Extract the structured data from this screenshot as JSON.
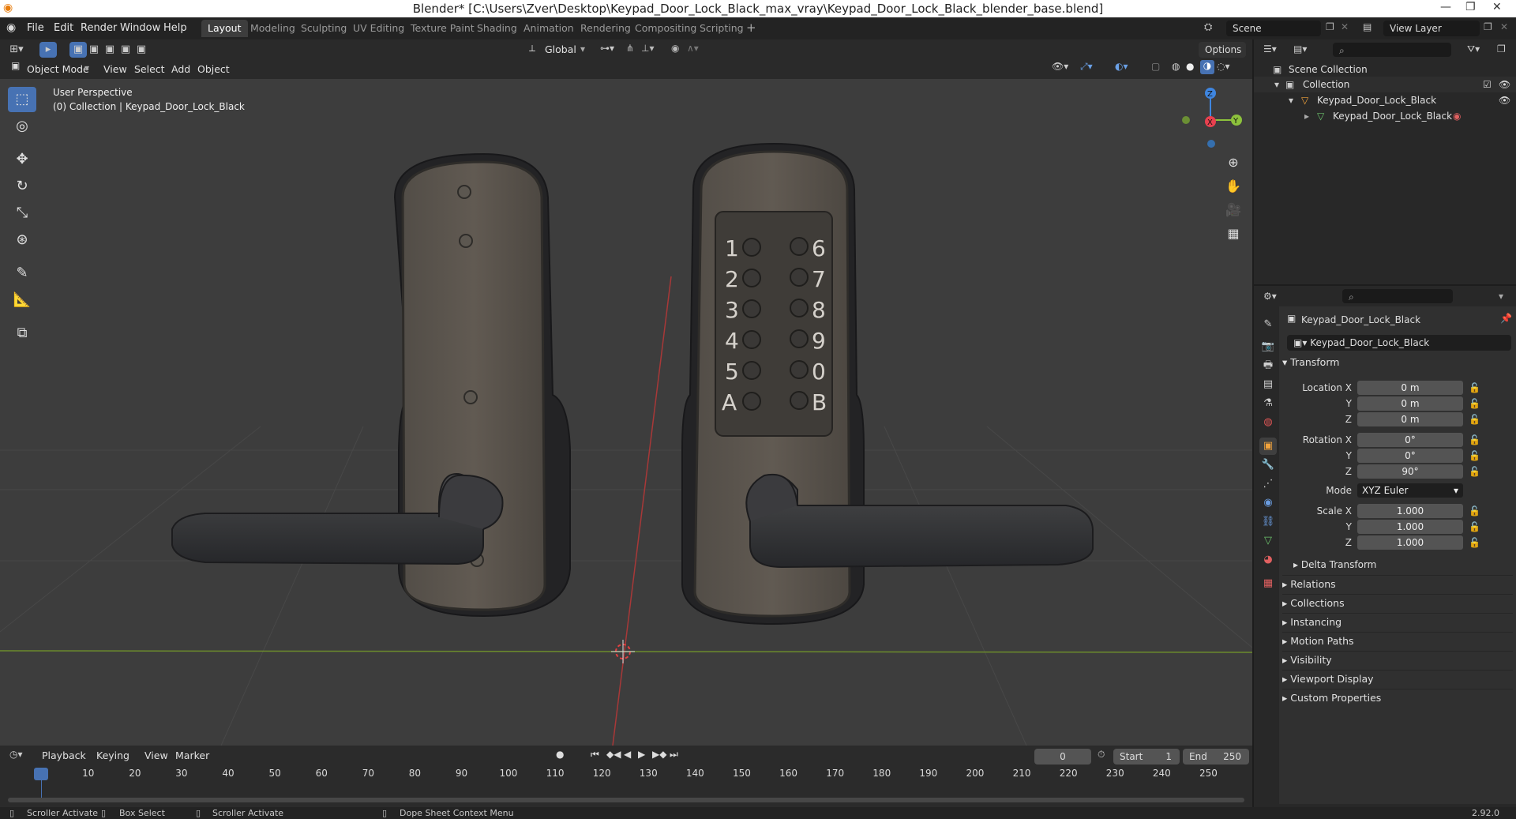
{
  "window": {
    "title": "Blender* [C:\\Users\\Zver\\Desktop\\Keypad_Door_Lock_Black_max_vray\\Keypad_Door_Lock_Black_blender_base.blend]",
    "controls": [
      "—",
      "❐",
      "✕"
    ]
  },
  "menubar": [
    "File",
    "Edit",
    "Render",
    "Window",
    "Help"
  ],
  "workspaces": [
    "Layout",
    "Modeling",
    "Sculpting",
    "UV Editing",
    "Texture Paint",
    "Shading",
    "Animation",
    "Rendering",
    "Compositing",
    "Scripting"
  ],
  "scene": {
    "label": "Scene",
    "view_layer": "View Layer"
  },
  "viewport": {
    "mode": "Object Mode",
    "menus": [
      "View",
      "Select",
      "Add",
      "Object"
    ],
    "transform_orientation": "Global",
    "options": "Options",
    "perspective": "User Perspective",
    "collection_info": "(0) Collection | Keypad_Door_Lock_Black",
    "gizmo": {
      "x": "X",
      "y": "Y",
      "z": "Z",
      "x_color": "#e8414f",
      "y_color": "#8dc23c",
      "z_color": "#3f86e0"
    },
    "keypad_left": [
      "1",
      "2",
      "3",
      "4",
      "5",
      "A"
    ],
    "keypad_right": [
      "6",
      "7",
      "8",
      "9",
      "0",
      "B"
    ]
  },
  "outliner": {
    "scene_collection": "Scene Collection",
    "collection": "Collection",
    "object": "Keypad_Door_Lock_Black",
    "mesh": "Keypad_Door_Lock_Black"
  },
  "properties": {
    "object_name": "Keypad_Door_Lock_Black",
    "datablock": "Keypad_Door_Lock_Black",
    "transform_title": "Transform",
    "location": {
      "label": "Location X",
      "x": "0 m",
      "y": "0 m",
      "z": "0 m"
    },
    "rotation": {
      "label": "Rotation X",
      "x": "0°",
      "y": "0°",
      "z": "90°"
    },
    "mode_label": "Mode",
    "mode_value": "XYZ Euler",
    "scale": {
      "label": "Scale X",
      "x": "1.000",
      "y": "1.000",
      "z": "1.000"
    },
    "axis_y": "Y",
    "axis_z": "Z",
    "sections": [
      "Delta Transform",
      "Relations",
      "Collections",
      "Instancing",
      "Motion Paths",
      "Visibility",
      "Viewport Display",
      "Custom Properties"
    ]
  },
  "timeline": {
    "menus": [
      "Playback",
      "Keying",
      "View",
      "Marker"
    ],
    "current_frame": "0",
    "start_label": "Start",
    "start": "1",
    "end_label": "End",
    "end": "250",
    "ticks": [
      "0",
      "10",
      "20",
      "30",
      "40",
      "50",
      "60",
      "70",
      "80",
      "90",
      "100",
      "110",
      "120",
      "130",
      "140",
      "150",
      "160",
      "170",
      "180",
      "190",
      "200",
      "210",
      "220",
      "230",
      "240",
      "250"
    ]
  },
  "statusbar": {
    "items": [
      "Scroller Activate",
      "Box Select",
      "Scroller Activate",
      "Dope Sheet Context Menu"
    ],
    "version": "2.92.0"
  },
  "colors": {
    "accent": "#4772b3",
    "x_axis": "#b33a3a",
    "y_axis": "#7a9a2c",
    "active_object": "#f2a33c"
  }
}
